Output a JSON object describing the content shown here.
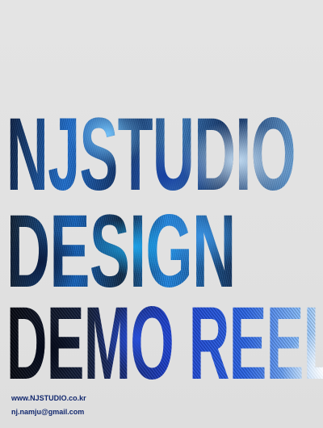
{
  "poster": {
    "title_lines": [
      "NJSTUDIO",
      "DESIGN",
      "DEMO REEL"
    ],
    "website": "www.NJSTUDIO.co.kr",
    "email": "nj.namju@gmail.com"
  },
  "colors": {
    "background": "#e2e2e2",
    "accent_blue": "#1e6fd0",
    "contact_text": "#12286e"
  }
}
